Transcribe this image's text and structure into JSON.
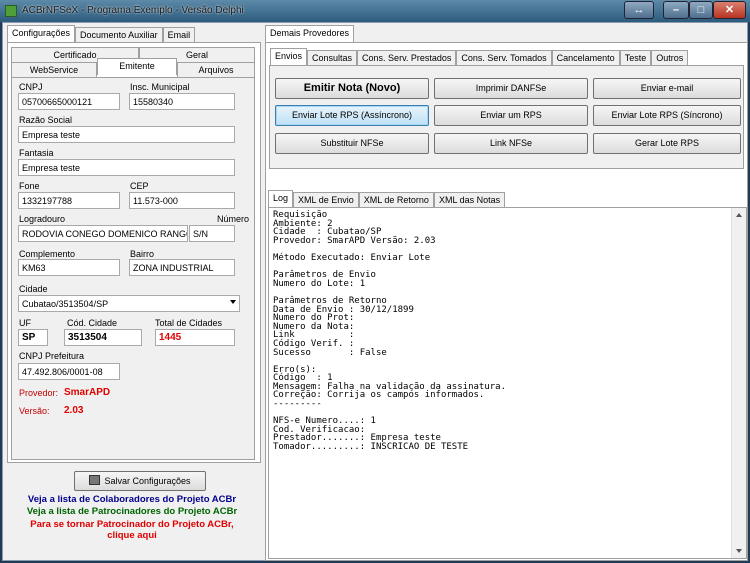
{
  "window": {
    "title": "ACBrNFSeX - Programa Exemplo - Versão Delphi"
  },
  "left": {
    "tabs": [
      "Configurações",
      "Documento Auxiliar",
      "Email"
    ],
    "subtabs_row1": [
      "Certificado",
      "Geral"
    ],
    "subtabs_row2": [
      "WebService",
      "Emitente",
      "Arquivos"
    ],
    "form": {
      "cnpj_label": "CNPJ",
      "cnpj": "05700665000121",
      "im_label": "Insc. Municipal",
      "im": "15580340",
      "razao_label": "Razão Social",
      "razao": "Empresa teste",
      "fantasia_label": "Fantasia",
      "fantasia": "Empresa teste",
      "fone_label": "Fone",
      "fone": "1332197788",
      "cep_label": "CEP",
      "cep": "11.573-000",
      "logradouro_label": "Logradouro",
      "logradouro": "RODOVIA CONEGO DOMENICO RANGO",
      "numero_label": "Número",
      "numero": "S/N",
      "complemento_label": "Complemento",
      "complemento": "KM63",
      "bairro_label": "Bairro",
      "bairro": "ZONA INDUSTRIAL",
      "cidade_label": "Cidade",
      "cidade": "Cubatao/3513504/SP",
      "uf_label": "UF",
      "uf": "SP",
      "cod_cidade_label": "Cód. Cidade",
      "cod_cidade": "3513504",
      "total_label": "Total de Cidades",
      "total": "1445",
      "cnpj_pref_label": "CNPJ Prefeitura",
      "cnpj_pref": "47.492.806/0001-08",
      "provedor_label": "Provedor:",
      "provedor": "SmarAPD",
      "versao_label": "Versão:",
      "versao": "2.03"
    },
    "save_button": "Salvar Configurações",
    "links": {
      "colaboradores": "Veja a lista de Colaboradores do Projeto ACBr",
      "patrocinadores": "Veja a lista de Patrocinadores do Projeto ACBr",
      "tornar1": "Para se tornar Patrocinador do Projeto ACBr,",
      "tornar2": "clique aqui"
    }
  },
  "right": {
    "outer_tab": "Demais Provedores",
    "tabs": [
      "Envios",
      "Consultas",
      "Cons. Serv. Prestados",
      "Cons. Serv. Tomados",
      "Cancelamento",
      "Teste",
      "Outros"
    ],
    "buttons": {
      "emitir": "Emitir Nota (Novo)",
      "imprimir": "Imprimir DANFSe",
      "email": "Enviar e-mail",
      "lote_async": "Enviar Lote RPS (Assíncrono)",
      "um_rps": "Enviar um RPS",
      "lote_sync": "Enviar Lote RPS (Síncrono)",
      "substituir": "Substituir NFSe",
      "link": "Link NFSe",
      "gerar": "Gerar Lote RPS"
    },
    "log_tabs": [
      "Log",
      "XML de Envio",
      "XML de Retorno",
      "XML das Notas"
    ],
    "log_lines": [
      "Requisição",
      "Ambiente: 2",
      "Cidade  : Cubatao/SP",
      "Provedor: SmarAPD Versão: 2.03",
      "",
      "Método Executado: Enviar Lote",
      "",
      "Parâmetros de Envio",
      "Numero do Lote: 1",
      "",
      "Parâmetros de Retorno",
      "Data de Envio : 30/12/1899",
      "Numero do Prot:",
      "Numero da Nota:",
      "Link          :",
      "Código Verif. :",
      "Sucesso       : False",
      "",
      "Erro(s):",
      "Código  : 1",
      "Mensagem: Falha na validação da assinatura.",
      "Correção: Corrija os campos informados.",
      "---------",
      "",
      "NFS-e Numero....: 1",
      "Cod. Verificacao:",
      "Prestador.......: Empresa teste",
      "Tomador.........: INSCRICAO DE TESTE"
    ]
  }
}
